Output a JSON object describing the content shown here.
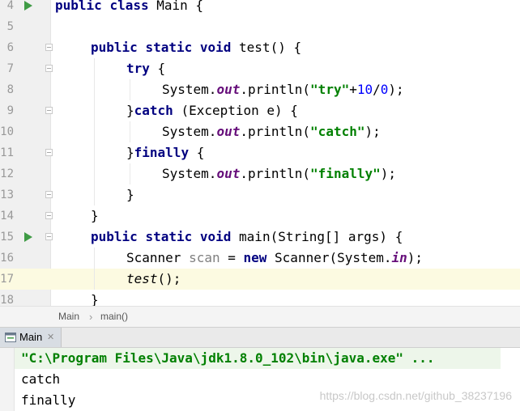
{
  "editor": {
    "lines": [
      {
        "num": "4",
        "run": true,
        "fold": false,
        "current": false,
        "tokens": [
          [
            "kw",
            "public"
          ],
          [
            "p",
            " "
          ],
          [
            "kw",
            "class"
          ],
          [
            "p",
            " Main {"
          ]
        ]
      },
      {
        "num": "5",
        "run": false,
        "fold": false,
        "current": false,
        "tokens": []
      },
      {
        "num": "6",
        "run": false,
        "fold": true,
        "current": false,
        "tokens": [
          [
            "kw",
            "public"
          ],
          [
            "p",
            " "
          ],
          [
            "kw",
            "static"
          ],
          [
            "p",
            " "
          ],
          [
            "kw",
            "void"
          ],
          [
            "p",
            " test() {"
          ]
        ]
      },
      {
        "num": "7",
        "run": false,
        "fold": true,
        "current": false,
        "tokens": [
          [
            "kw",
            "try"
          ],
          [
            "p",
            " {"
          ]
        ]
      },
      {
        "num": "8",
        "run": false,
        "fold": false,
        "current": false,
        "tokens": [
          [
            "p",
            "System."
          ],
          [
            "fld",
            "out"
          ],
          [
            "p",
            ".println("
          ],
          [
            "str",
            "\"try\""
          ],
          [
            "p",
            "+"
          ],
          [
            "num",
            "10"
          ],
          [
            "p",
            "/"
          ],
          [
            "num",
            "0"
          ],
          [
            "p",
            ");"
          ]
        ]
      },
      {
        "num": "9",
        "run": false,
        "fold": true,
        "current": false,
        "tokens": [
          [
            "p",
            "}"
          ],
          [
            "kw",
            "catch"
          ],
          [
            "p",
            " (Exception e) {"
          ]
        ]
      },
      {
        "num": "10",
        "run": false,
        "fold": false,
        "current": false,
        "tokens": [
          [
            "p",
            "System."
          ],
          [
            "fld",
            "out"
          ],
          [
            "p",
            ".println("
          ],
          [
            "str",
            "\"catch\""
          ],
          [
            "p",
            ");"
          ]
        ]
      },
      {
        "num": "11",
        "run": false,
        "fold": true,
        "current": false,
        "tokens": [
          [
            "p",
            "}"
          ],
          [
            "kw",
            "finally"
          ],
          [
            "p",
            " {"
          ]
        ]
      },
      {
        "num": "12",
        "run": false,
        "fold": false,
        "current": false,
        "tokens": [
          [
            "p",
            "System."
          ],
          [
            "fld",
            "out"
          ],
          [
            "p",
            ".println("
          ],
          [
            "str",
            "\"finally\""
          ],
          [
            "p",
            ");"
          ]
        ]
      },
      {
        "num": "13",
        "run": false,
        "fold": true,
        "current": false,
        "tokens": [
          [
            "p",
            "}"
          ]
        ]
      },
      {
        "num": "14",
        "run": false,
        "fold": true,
        "current": false,
        "tokens": [
          [
            "p",
            "}"
          ]
        ]
      },
      {
        "num": "15",
        "run": true,
        "fold": true,
        "current": false,
        "tokens": [
          [
            "kw",
            "public"
          ],
          [
            "p",
            " "
          ],
          [
            "kw",
            "static"
          ],
          [
            "p",
            " "
          ],
          [
            "kw",
            "void"
          ],
          [
            "p",
            " main(String[] args) {"
          ]
        ]
      },
      {
        "num": "16",
        "run": false,
        "fold": false,
        "current": false,
        "tokens": [
          [
            "p",
            "Scanner "
          ],
          [
            "var",
            "scan"
          ],
          [
            "p",
            " = "
          ],
          [
            "kw",
            "new"
          ],
          [
            "p",
            " Scanner(System."
          ],
          [
            "fld",
            "in"
          ],
          [
            "p",
            ");"
          ]
        ]
      },
      {
        "num": "17",
        "run": false,
        "fold": false,
        "current": true,
        "tokens": [
          [
            "ital",
            "test"
          ],
          [
            "p",
            "();"
          ]
        ]
      },
      {
        "num": "18",
        "run": false,
        "fold": false,
        "current": false,
        "tokens": [
          [
            "p",
            "}"
          ]
        ]
      }
    ]
  },
  "breadcrumb": {
    "class": "Main",
    "separator": "›",
    "method": "main()"
  },
  "run_panel": {
    "tab_label": "Main",
    "close_glyph": "✕"
  },
  "console": {
    "command": "\"C:\\Program Files\\Java\\jdk1.8.0_102\\bin\\java.exe\" ...",
    "output": [
      "catch",
      "finally"
    ]
  },
  "watermark": "https://blog.csdn.net/github_38237196",
  "colors": {
    "keyword": "#000080",
    "string": "#008000",
    "number": "#0000ff",
    "field": "#660e7a",
    "run_icon": "#3f9b45",
    "current_line": "#fcfae1"
  }
}
